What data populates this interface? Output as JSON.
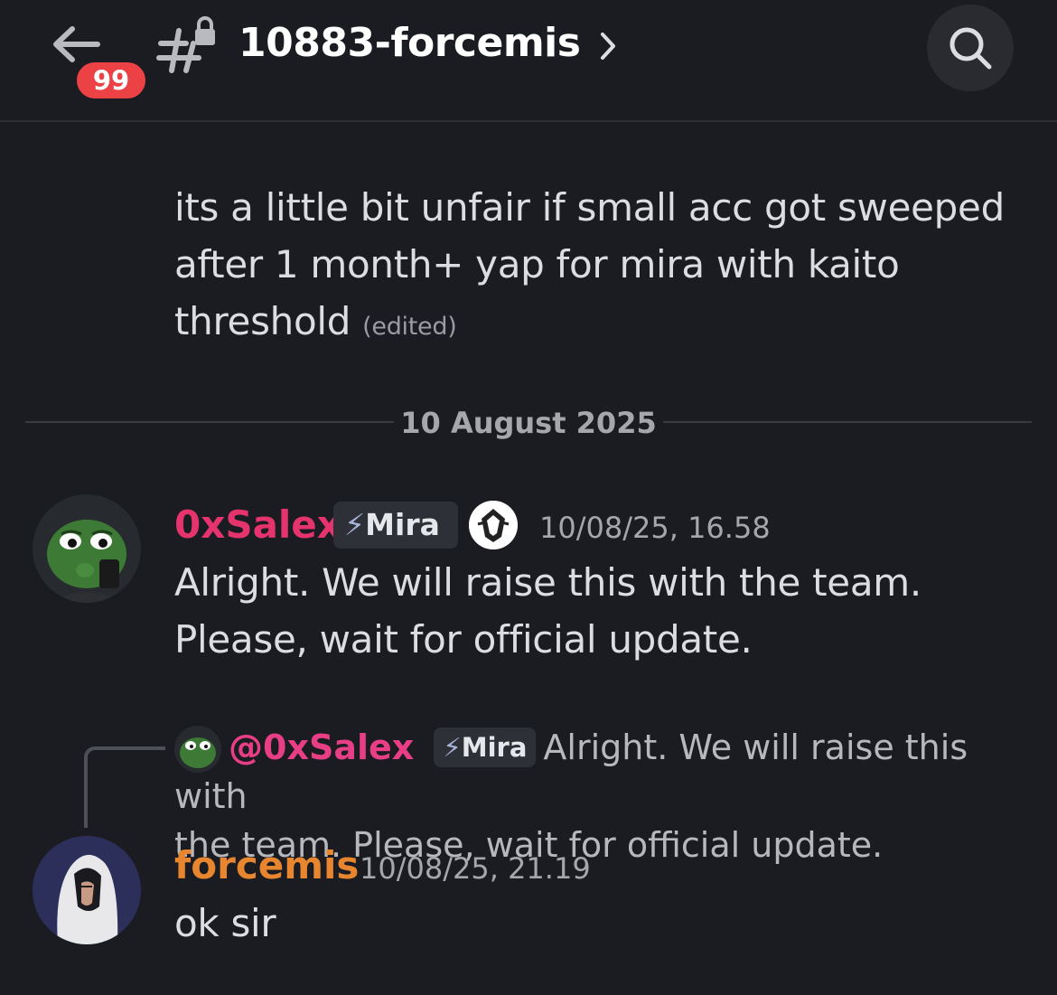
{
  "header": {
    "back_icon": "arrow-left-icon",
    "unread_badge": "99",
    "channel_icon": "locked-hash-icon",
    "channel_name": "10883-forcemis",
    "chevron_icon": "chevron-right-icon",
    "search_icon": "search-icon"
  },
  "messages": [
    {
      "text": "its a little bit unfair if small acc got sweeped after 1 month+ yap for mira with kaito threshold",
      "line1": "its a little bit unfair if small acc got sweeped",
      "line2": "after 1 month+ yap for mira with kaito",
      "line3": "threshold",
      "edited_label": "(edited)"
    }
  ],
  "date_divider": "10 August 2025",
  "post1": {
    "username": "0xSalex",
    "username_color": "#e5336e",
    "role_icon": "lightning-bolt-icon",
    "role": "Mira",
    "server_badge_icon": "server-tag-icon",
    "timestamp": "10/08/25, 16.58",
    "line1": "Alright. We will raise this with the team.",
    "line2": "Please, wait for official update."
  },
  "post2": {
    "reply": {
      "mention": "@0xSalex",
      "role": "Mira",
      "line1": "Alright. We will raise this with",
      "line2": "the team. Please, wait for official update."
    },
    "username": "forcemis",
    "username_color": "#e8862f",
    "timestamp": "10/08/25, 21.19",
    "text": "ok sir"
  },
  "colors": {
    "background": "#1b1c21",
    "badge_red": "#ed4245",
    "text": "#dcdde2",
    "muted": "#a6a7ad"
  }
}
